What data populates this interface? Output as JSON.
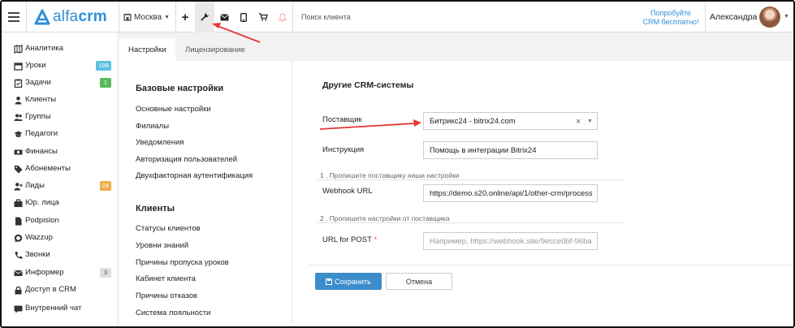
{
  "app": {
    "logo_text_a": "alfa",
    "logo_text_b": "crm",
    "brand_color": "#2e8fd8"
  },
  "topbar": {
    "city": "Москва",
    "search_placeholder": "Поиск клиента",
    "try_free_line1": "Попробуйте",
    "try_free_line2": "CRM бесплатно!",
    "user_name": "Александра",
    "icons": [
      "menu-icon",
      "home-icon",
      "plus-icon",
      "wrench-icon",
      "mail-icon",
      "mobile-icon",
      "cart-icon",
      "bell-icon"
    ]
  },
  "sidebar": {
    "items": [
      {
        "label": "Аналитика",
        "icon": "map-icon"
      },
      {
        "label": "Уроки",
        "icon": "calendar-icon",
        "badge": "108",
        "badge_color": "#5bc0de"
      },
      {
        "label": "Задачи",
        "icon": "clipboard-icon",
        "badge": "1",
        "badge_color": "#5cb85c"
      },
      {
        "label": "Клиенты",
        "icon": "user-icon"
      },
      {
        "label": "Группы",
        "icon": "users-icon"
      },
      {
        "label": "Педагоги",
        "icon": "graduation-cap-icon"
      },
      {
        "label": "Финансы",
        "icon": "money-icon"
      },
      {
        "label": "Абонементы",
        "icon": "tag-icon"
      },
      {
        "label": "Лиды",
        "icon": "user-plus-icon",
        "badge": "24",
        "badge_color": "#f0ad4e"
      },
      {
        "label": "Юр. лица",
        "icon": "briefcase-icon"
      },
      {
        "label": "Podpislon",
        "icon": "document-icon"
      },
      {
        "label": "Wazzup",
        "icon": "whatsapp-icon"
      },
      {
        "label": "Звонки",
        "icon": "phone-icon"
      },
      {
        "label": "Информер",
        "icon": "envelope-icon",
        "badge": "3",
        "badge_color": "#dddddd"
      },
      {
        "label": "Доступ в CRM",
        "icon": "lock-icon"
      },
      {
        "label": "Внутренний чат",
        "icon": "chat-icon"
      }
    ]
  },
  "tabs": [
    {
      "label": "Настройки",
      "active": true
    },
    {
      "label": "Лицензирование",
      "active": false
    }
  ],
  "settings_menu": {
    "basic_title": "Базовые настройки",
    "basic_links": [
      "Основные настройки",
      "Филиалы",
      "Уведомления",
      "Авторизация пользователей",
      "Двухфакторная аутентификация"
    ],
    "clients_title": "Клиенты",
    "clients_links": [
      "Статусы клиентов",
      "Уровни знаний",
      "Причины пропуска уроков",
      "Кабинет клиента",
      "Причины отказов",
      "Система лояльности"
    ]
  },
  "form": {
    "title": "Другие CRM-системы",
    "provider_label": "Поставщик",
    "provider_value": "Битрикс24 - bitrix24.com",
    "instruction_label": "Инструкция",
    "instruction_value": "Помощь в интеграции Bitrix24",
    "step1_hint": "1 . Пропишите поставщику наши настройки",
    "webhook_label": "Webhook URL",
    "webhook_value": "https://demo.s20.online/api/1/other-crm/process",
    "step2_hint": "2 . Пропишите настройки от поставщика",
    "post_url_label": "URL for POST",
    "post_url_required": "*",
    "post_url_placeholder": "Например, https://webhook.site/9ecce0bf-96ba",
    "save_label": "Сохранить",
    "cancel_label": "Отмена"
  },
  "colors": {
    "save_button": "#3c8dcb",
    "annotation_arrow": "#e53935",
    "required_mark": "#d9534f"
  }
}
